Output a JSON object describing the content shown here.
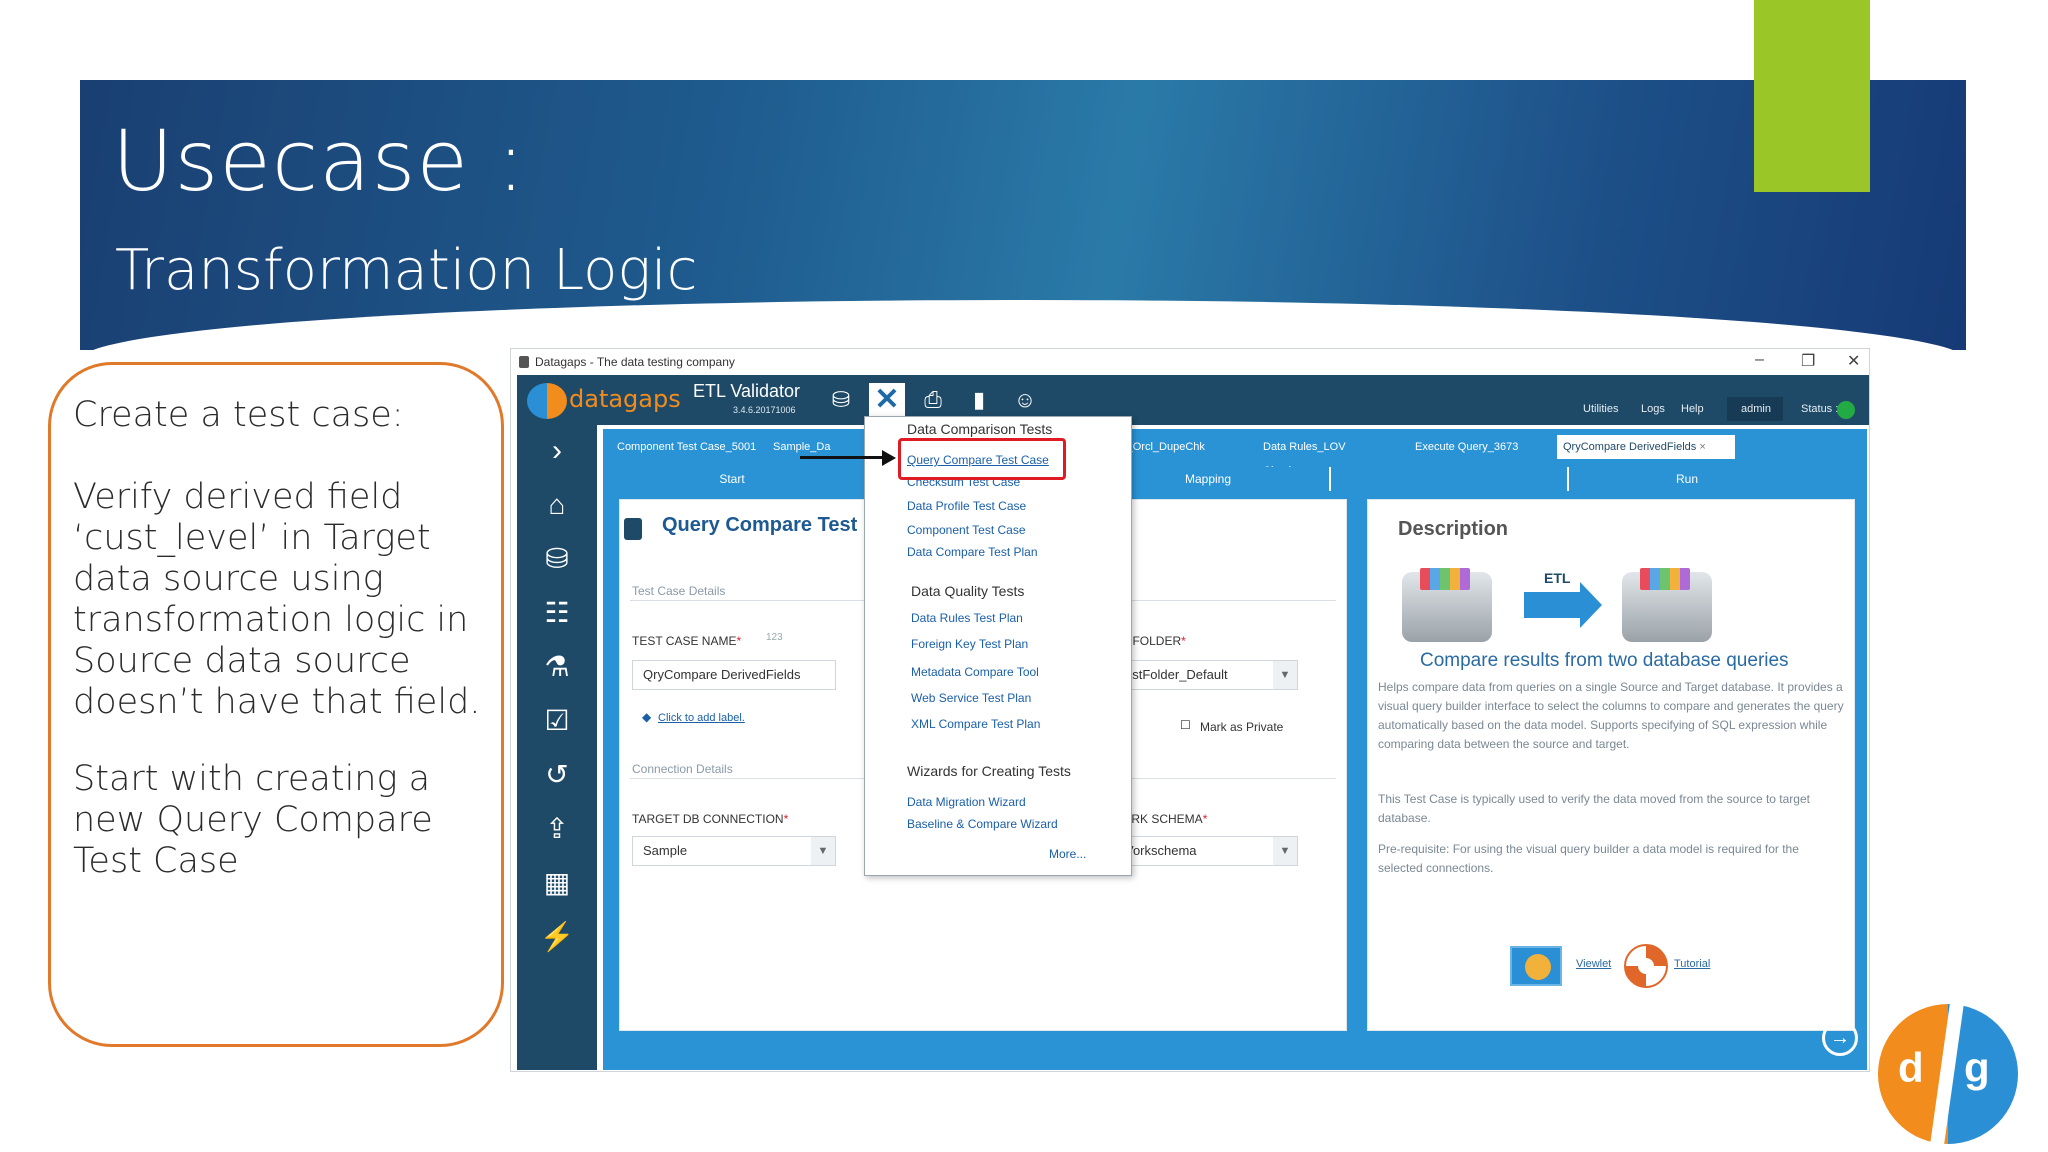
{
  "slide": {
    "title": "Usecase :",
    "subtitle": "Transformation Logic",
    "callout": {
      "p1": "Create a test case:",
      "p2": "Verify derived field ‘cust_level’ in Target data source using transformation logic in Source data source doesn’t have that field.",
      "p3": "Start with creating a new Query Compare Test Case"
    }
  },
  "app": {
    "window_title": "Datagaps - The data testing company",
    "brand": "datagaps",
    "product": "ETL Validator",
    "version": "3.4.6.20171006",
    "top_links": [
      "Utilities",
      "Logs",
      "Help",
      "admin",
      "Status :"
    ],
    "tabs": [
      "Component Test Case_5001",
      "Sample_Da",
      "es_Orcl_DupeChk",
      "Data Rules_LOV Check",
      "Execute Query_3673",
      "QryCompare DerivedFields"
    ],
    "close_glyph": "×",
    "steps": [
      "Start",
      "Mapping",
      "Run"
    ],
    "qc_title": "Query Compare Test",
    "test_case_details": "Test Case Details",
    "test_case_name_label": "TEST CASE NAME",
    "required_mark": "*",
    "test_case_name_hint": "123",
    "test_case_name_value": "QryCompare DerivedFields",
    "add_label_link": "Click to add label.",
    "test_folder_label": "T FOLDER",
    "test_folder_value": "estFolder_Default",
    "mark_private": "Mark as Private",
    "connection_details": "Connection Details",
    "target_db_label": "TARGET DB CONNECTION",
    "target_db_value": "Sample",
    "work_schema_label": "ORK SCHEMA",
    "work_schema_value": "Vorkschema",
    "description_title": "Description",
    "etl_label": "ETL",
    "desc_subtitle": "Compare results from two database queries",
    "desc_p1": "Helps compare data from queries on a single Source and Target database. It provides a visual query builder interface to select the columns to compare and generates the query automatically based on the data model. Supports specifying of SQL expression while comparing data between the source and target.",
    "desc_p2": "This Test Case is typically used to verify the data moved from the source to target database.",
    "desc_p3": "Pre-requisite: For using the visual query builder a data model is required for the selected connections.",
    "viewlet": "Viewlet",
    "tutorial": "Tutorial"
  },
  "menu": {
    "h1": "Data Comparison Tests",
    "items1": [
      "Query Compare Test Case",
      "Checksum Test Case",
      "Data Profile Test Case",
      "Component Test Case",
      "Data Compare Test Plan"
    ],
    "h2": "Data Quality Tests",
    "items2": [
      "Data Rules Test Plan",
      "Foreign Key Test Plan",
      "Metadata Compare Tool",
      "Web Service Test Plan",
      "XML Compare Test Plan"
    ],
    "h3": "Wizards for Creating Tests",
    "items3": [
      "Data Migration Wizard",
      "Baseline & Compare Wizard"
    ],
    "more": "More..."
  },
  "colors": {
    "accent_blue": "#2a93d5",
    "nav_dark": "#1e4a68",
    "orange": "#e07a2a",
    "green": "#9bc628",
    "highlight_red": "#e01b24"
  },
  "icons": [
    "home-icon",
    "database-icon",
    "hierarchy-icon",
    "flask-icon",
    "checkbox-icon",
    "history-icon",
    "export-icon",
    "calendar-icon",
    "flash-icon"
  ]
}
